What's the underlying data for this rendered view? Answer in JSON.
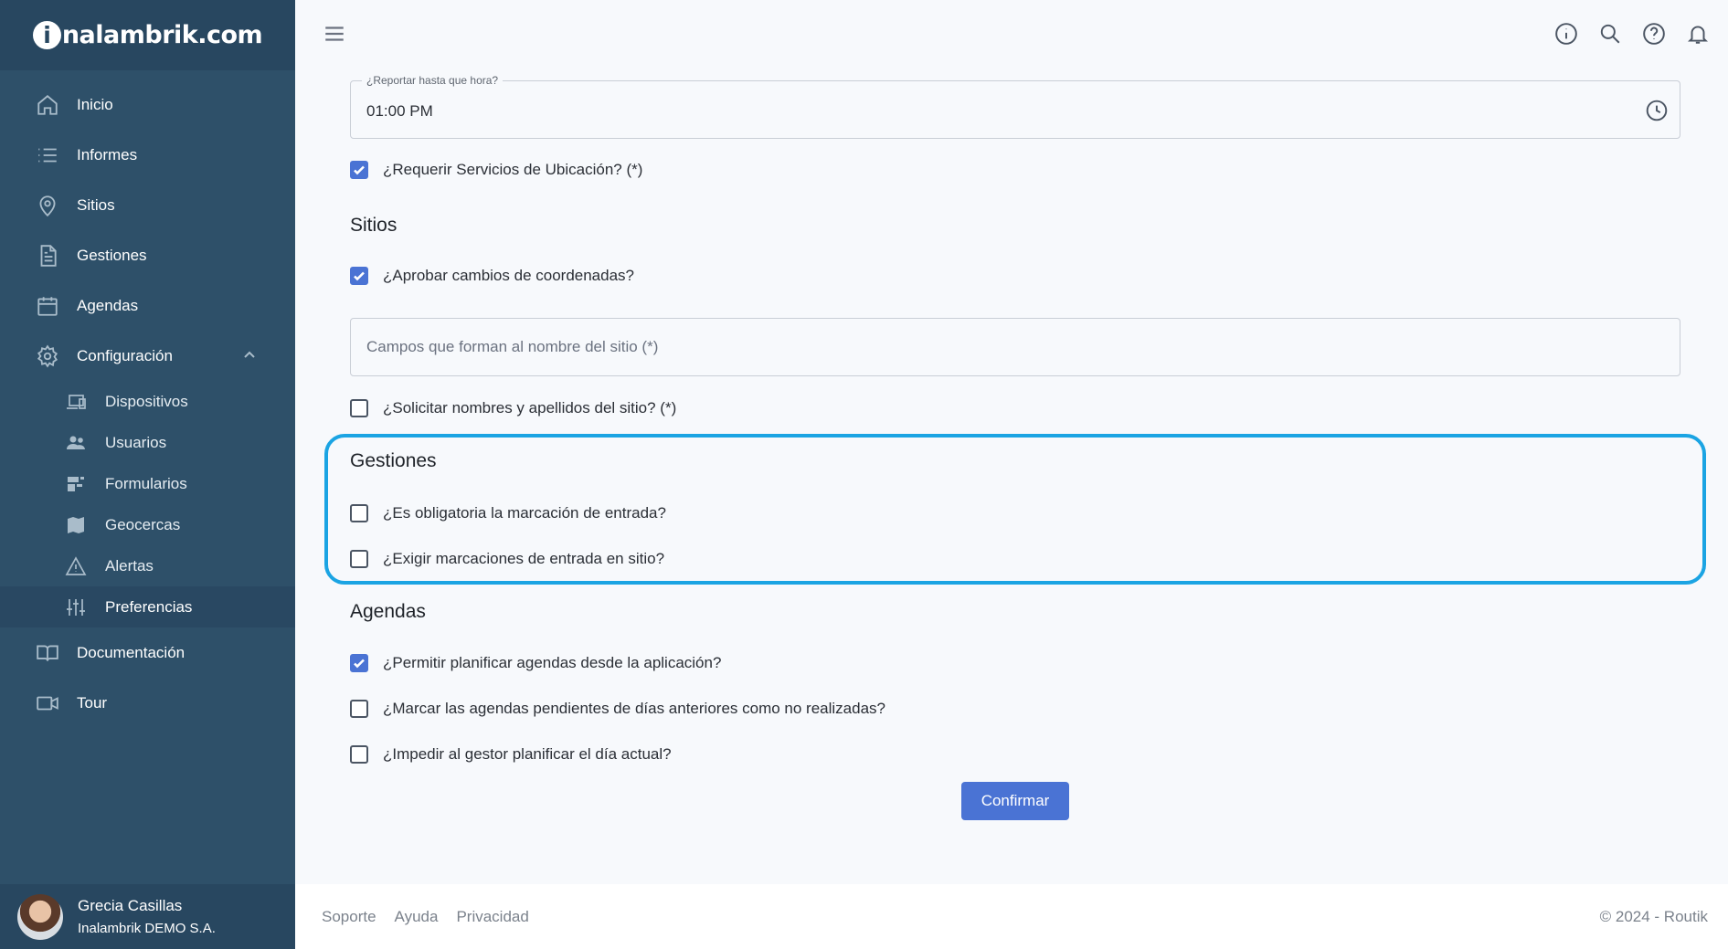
{
  "brand": {
    "logo_letter": "i",
    "logo_rest": "nalambrik.com"
  },
  "sidebar": {
    "items": [
      {
        "label": "Inicio",
        "icon": "home-icon"
      },
      {
        "label": "Informes",
        "icon": "list-icon"
      },
      {
        "label": "Sitios",
        "icon": "map-pin-icon"
      },
      {
        "label": "Gestiones",
        "icon": "document-icon"
      },
      {
        "label": "Agendas",
        "icon": "calendar-icon"
      },
      {
        "label": "Configuración",
        "icon": "gear-icon"
      }
    ],
    "sub_items": [
      {
        "label": "Dispositivos",
        "icon": "devices-icon"
      },
      {
        "label": "Usuarios",
        "icon": "users-icon"
      },
      {
        "label": "Formularios",
        "icon": "forms-icon"
      },
      {
        "label": "Geocercas",
        "icon": "map-icon"
      },
      {
        "label": "Alertas",
        "icon": "warning-icon"
      },
      {
        "label": "Preferencias",
        "icon": "sliders-icon",
        "active": true
      }
    ],
    "bottom_items": [
      {
        "label": "Documentación",
        "icon": "book-icon"
      },
      {
        "label": "Tour",
        "icon": "video-icon"
      }
    ]
  },
  "user": {
    "name": "Grecia Casillas",
    "org": "Inalambrik DEMO S.A."
  },
  "form": {
    "time_field": {
      "legend": "¿Reportar hasta que hora?",
      "value": "01:00 PM"
    },
    "require_location": {
      "label": "¿Requerir Servicios de Ubicación? (*)",
      "checked": true
    },
    "sites_title": "Sitios",
    "approve_coords": {
      "label": "¿Aprobar cambios de coordenadas?",
      "checked": true
    },
    "site_name_fields": {
      "placeholder": "Campos que forman al nombre del sitio (*)"
    },
    "request_names": {
      "label": "¿Solicitar nombres y apellidos del sitio? (*)",
      "checked": false
    },
    "gestiones_title": "Gestiones",
    "entry_mandatory": {
      "label": "¿Es obligatoria la marcación de entrada?",
      "checked": false
    },
    "entry_on_site": {
      "label": "¿Exigir marcaciones de entrada en sitio?",
      "checked": false
    },
    "agendas_title": "Agendas",
    "allow_planning": {
      "label": "¿Permitir planificar agendas desde la aplicación?",
      "checked": true
    },
    "mark_pending": {
      "label": "¿Marcar las agendas pendientes de días anteriores como no realizadas?",
      "checked": false
    },
    "prevent_today": {
      "label": "¿Impedir al gestor planificar el día actual?",
      "checked": false
    },
    "confirm_label": "Confirmar"
  },
  "footer": {
    "links": [
      "Soporte",
      "Ayuda",
      "Privacidad"
    ],
    "copyright": "© 2024 - Routik"
  },
  "colors": {
    "sidebar": "#2e5069",
    "accent": "#4a73d4",
    "highlight": "#1ba4e3"
  }
}
